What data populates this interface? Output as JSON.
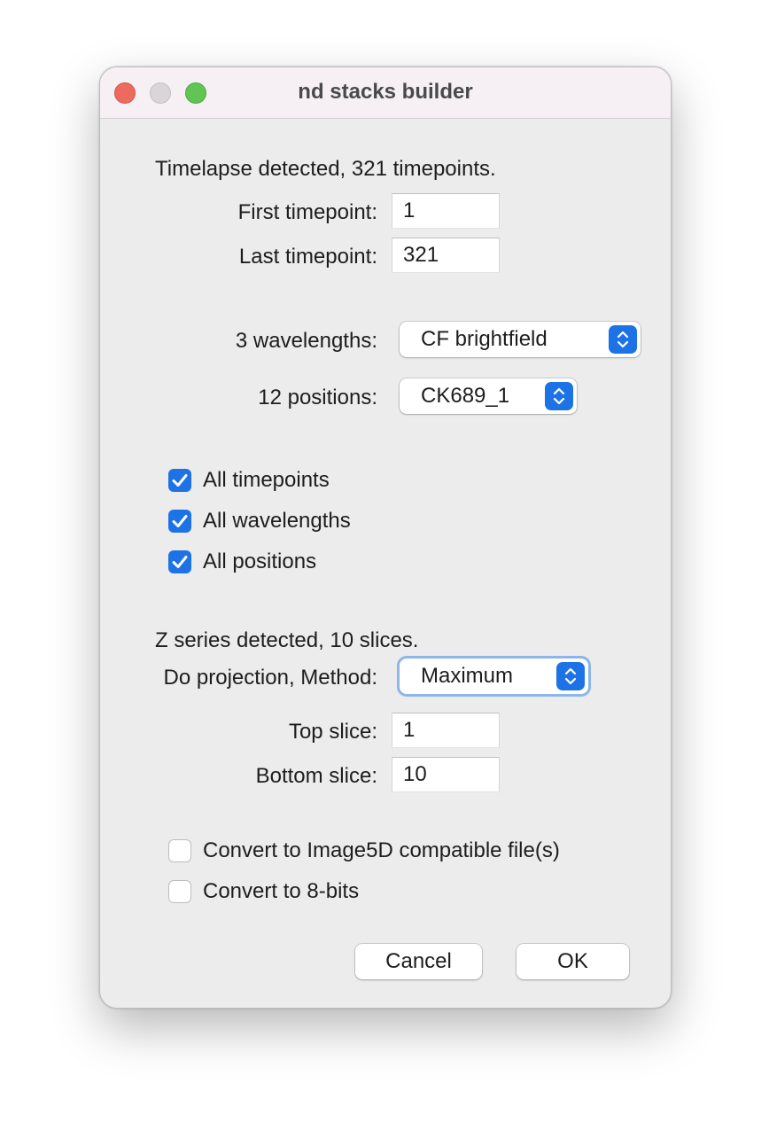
{
  "window": {
    "title": "nd stacks builder"
  },
  "timelapse": {
    "info": "Timelapse detected, 321 timepoints.",
    "first_label": "First timepoint:",
    "first_value": "1",
    "last_label": "Last timepoint:",
    "last_value": "321"
  },
  "wavelengths": {
    "label": "3 wavelengths:",
    "selected": "CF brightfield"
  },
  "positions": {
    "label": "12 positions:",
    "selected": "CK689_1"
  },
  "checkboxes": {
    "all_timepoints": {
      "label": "All timepoints",
      "checked": true
    },
    "all_wavelengths": {
      "label": "All wavelengths",
      "checked": true
    },
    "all_positions": {
      "label": "All positions",
      "checked": true
    }
  },
  "zseries": {
    "info": "Z series detected, 10 slices.",
    "method_label": "Do projection, Method:",
    "method_selected": "Maximum",
    "top_label": "Top slice:",
    "top_value": "1",
    "bottom_label": "Bottom slice:",
    "bottom_value": "10"
  },
  "options": {
    "image5d": {
      "label": "Convert to Image5D compatible file(s)",
      "checked": false
    },
    "eight_bits": {
      "label": "Convert to 8-bits",
      "checked": false
    }
  },
  "buttons": {
    "cancel": "Cancel",
    "ok": "OK"
  },
  "colors": {
    "accent": "#1d73e6",
    "close": "#ed6a5e",
    "zoom": "#61c554",
    "minimize_inactive": "#d9d5d8"
  }
}
